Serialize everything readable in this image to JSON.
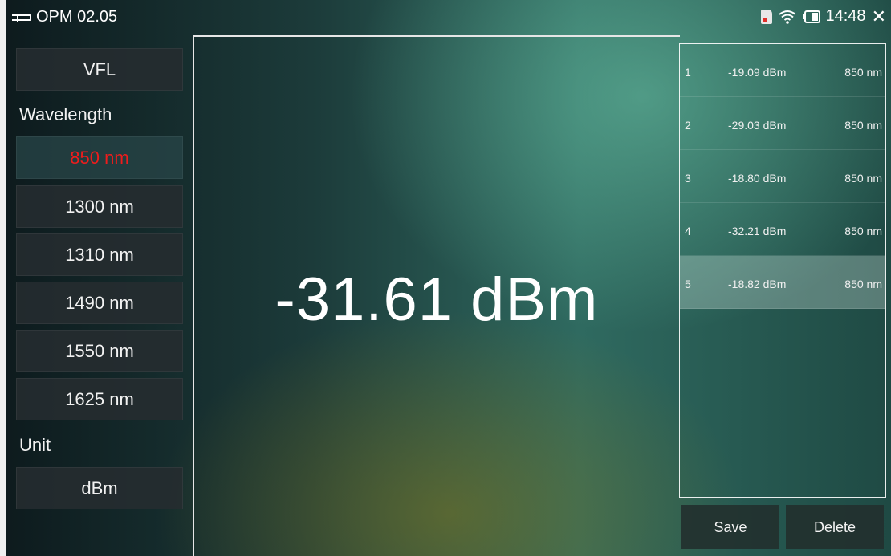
{
  "statusbar": {
    "title": "OPM 02.05",
    "time": "14:48",
    "icons": [
      "fiber-connector-icon",
      "sd-card-icon",
      "wifi-icon",
      "battery-icon",
      "close-icon"
    ]
  },
  "sidebar": {
    "vfl_label": "VFL",
    "wavelength_heading": "Wavelength",
    "wavelengths": [
      "850 nm",
      "1300 nm",
      "1310 nm",
      "1490 nm",
      "1550 nm",
      "1625 nm"
    ],
    "selected_wavelength": "850 nm",
    "unit_heading": "Unit",
    "unit_value": "dBm"
  },
  "main": {
    "reading": "-31.61 dBm"
  },
  "records": [
    {
      "index": "1",
      "value": "-19.09 dBm",
      "wavelength": "850 nm"
    },
    {
      "index": "2",
      "value": "-29.03 dBm",
      "wavelength": "850 nm"
    },
    {
      "index": "3",
      "value": "-18.80 dBm",
      "wavelength": "850 nm"
    },
    {
      "index": "4",
      "value": "-32.21 dBm",
      "wavelength": "850 nm"
    },
    {
      "index": "5",
      "value": "-18.82 dBm",
      "wavelength": "850 nm"
    }
  ],
  "selected_record": "5",
  "actions": {
    "save_label": "Save",
    "delete_label": "Delete"
  },
  "colors": {
    "selected_wavelength_text": "#ee1c1c",
    "divider": "#e6e6e6"
  }
}
